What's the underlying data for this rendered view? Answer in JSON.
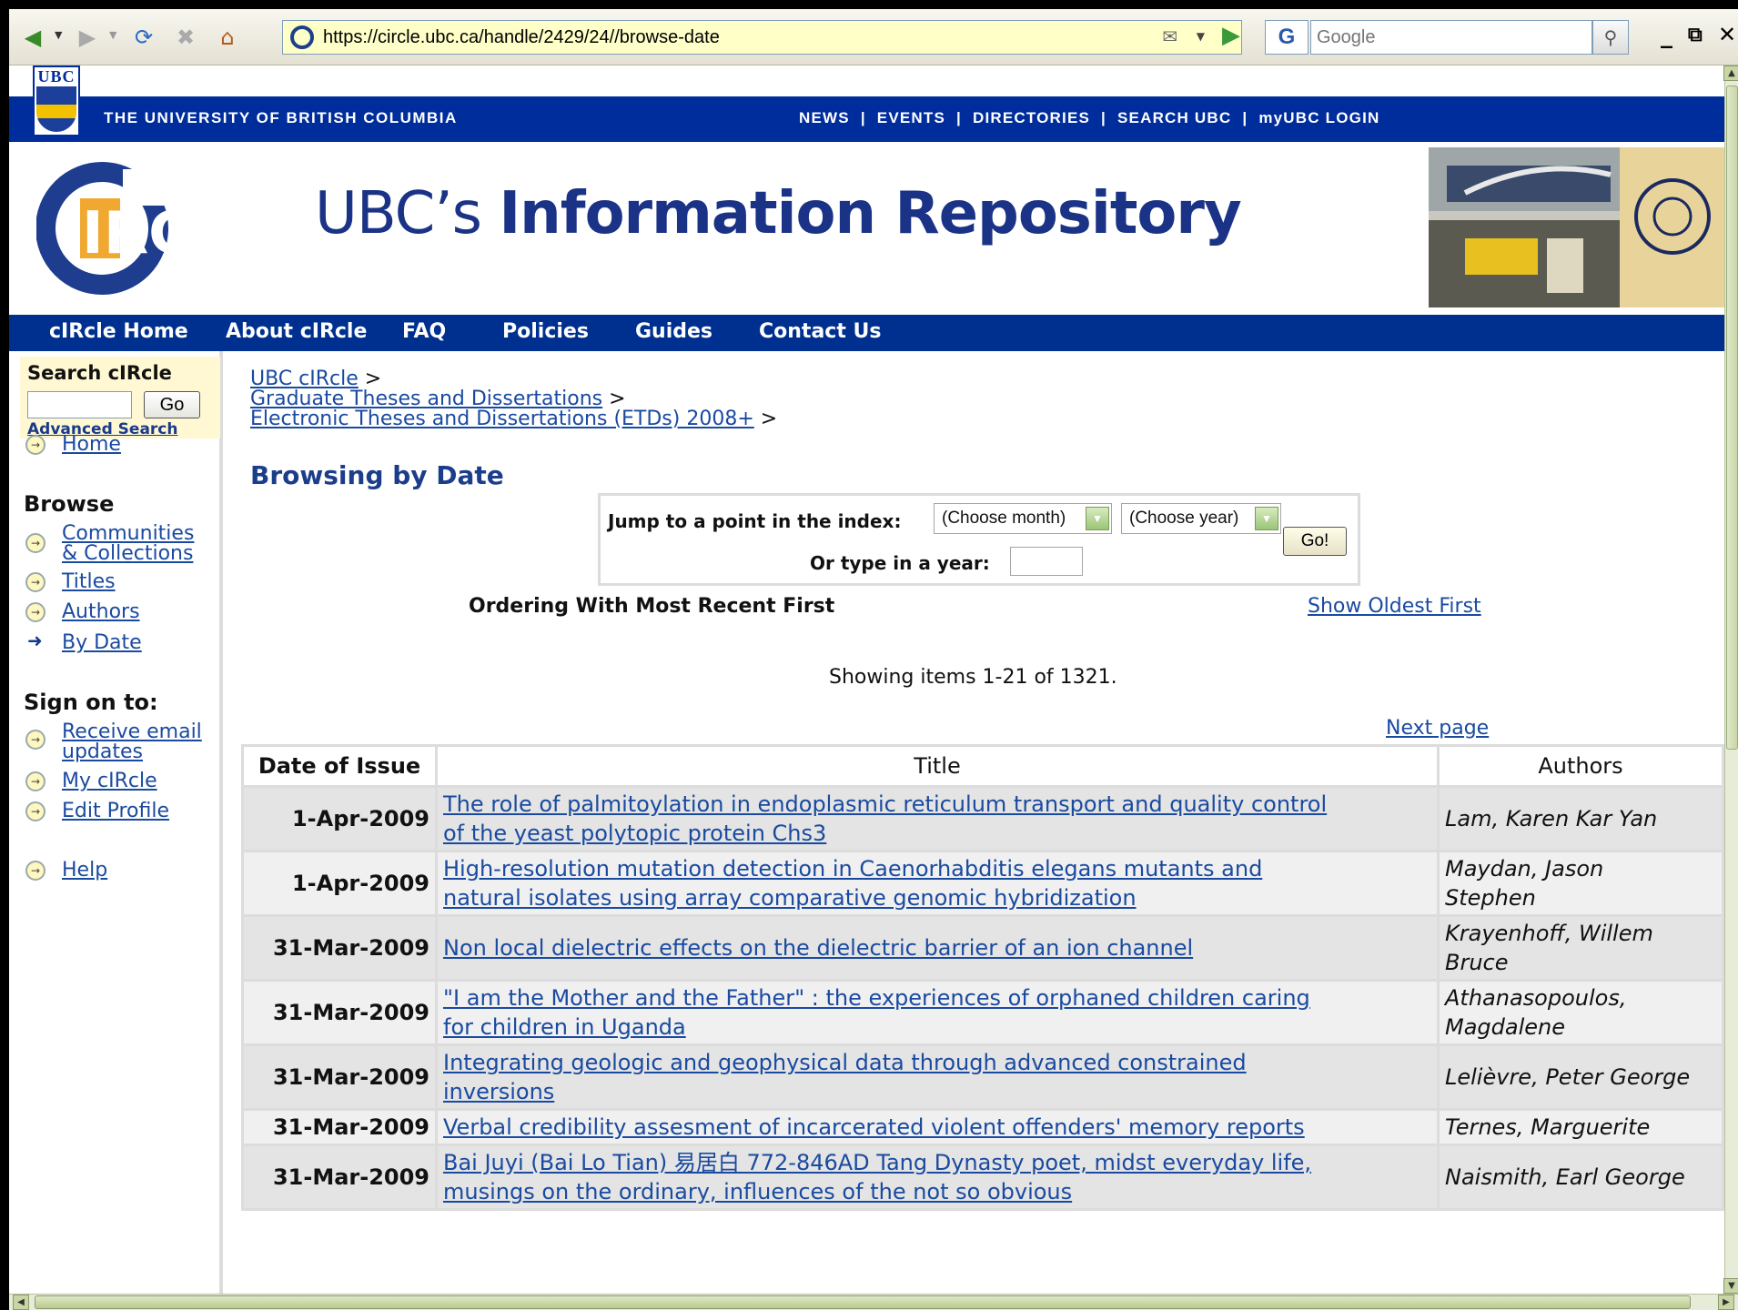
{
  "browser": {
    "url": "https://circle.ubc.ca/handle/2429/24//browse-date",
    "search_placeholder": "Google",
    "search_engine_label": "G"
  },
  "ubc_header": {
    "logo_text": "UBC",
    "university_name": "THE UNIVERSITY OF  BRITISH COLUMBIA",
    "links": [
      "NEWS",
      "EVENTS",
      "DIRECTORIES",
      "SEARCH UBC",
      "myUBC LOGIN"
    ]
  },
  "banner": {
    "logo_text": "IRCLE",
    "title_prefix": "UBC’s ",
    "title_bold": "Information Repository"
  },
  "nav": {
    "items": [
      "cIRcle Home",
      "About cIRcle",
      "FAQ",
      "Policies",
      "Guides",
      "Contact Us"
    ]
  },
  "sidebar": {
    "search_title": "Search cIRcle",
    "go_label": "Go",
    "advanced_search": "Advanced Search",
    "home": "Home",
    "browse_heading": "Browse",
    "browse_items": [
      "Communities",
      "& Collections",
      "Titles",
      "Authors",
      "By Date"
    ],
    "signon_heading": "Sign on to:",
    "signon_items": [
      "Receive email",
      "updates",
      "My cIRcle",
      "Edit Profile"
    ],
    "help": "Help"
  },
  "breadcrumbs": [
    "UBC cIRcle",
    "Graduate Theses and Dissertations",
    "Electronic Theses and Dissertations (ETDs) 2008+"
  ],
  "breadcrumb_sep": ">",
  "page_title": "Browsing by Date",
  "jump": {
    "label": "Jump to a point in the index:",
    "month_select": "(Choose month)",
    "year_select": "(Choose year)",
    "year_label": "Or type in a year:",
    "go_label": "Go!"
  },
  "ordering_text": "Ordering With Most Recent First",
  "show_oldest": "Show Oldest First",
  "showing": "Showing items 1-21 of 1321.",
  "next_page": "Next page",
  "table": {
    "headers": [
      "Date of Issue",
      "Title",
      "Authors"
    ],
    "rows": [
      {
        "date": "1-Apr-2009",
        "title_lines": [
          "The role of palmitoylation in endoplasmic reticulum transport and quality control",
          "of the yeast polytopic protein Chs3"
        ],
        "author_lines": [
          "Lam, Karen Kar Yan"
        ]
      },
      {
        "date": "1-Apr-2009",
        "title_lines": [
          "High-resolution mutation detection in Caenorhabditis elegans mutants and",
          "natural isolates using array comparative genomic hybridization"
        ],
        "author_lines": [
          "Maydan, Jason",
          "Stephen"
        ]
      },
      {
        "date": "31-Mar-2009",
        "title_lines": [
          "Non local dielectric effects on the dielectric barrier of an ion channel"
        ],
        "author_lines": [
          "Krayenhoff, Willem",
          "Bruce"
        ]
      },
      {
        "date": "31-Mar-2009",
        "title_lines": [
          "\"I am the Mother and the Father\" : the experiences of orphaned children caring",
          "for children in Uganda"
        ],
        "author_lines": [
          "Athanasopoulos,",
          "Magdalene"
        ]
      },
      {
        "date": "31-Mar-2009",
        "title_lines": [
          "Integrating geologic and geophysical data through advanced constrained",
          "inversions"
        ],
        "author_lines": [
          "Lelièvre, Peter George"
        ]
      },
      {
        "date": "31-Mar-2009",
        "title_lines": [
          "Verbal credibility assesment of incarcerated violent offenders' memory reports"
        ],
        "author_lines": [
          "Ternes, Marguerite"
        ]
      },
      {
        "date": "31-Mar-2009",
        "title_lines": [
          "Bai Juyi (Bai Lo Tian) 易居白 772-846AD Tang Dynasty poet, midst everyday life,",
          "musings on the ordinary, influences of the not so obvious"
        ],
        "author_lines": [
          "Naismith, Earl George"
        ]
      }
    ]
  },
  "colors": {
    "ubc_blue": "#002d9c",
    "nav_blue": "#00308f",
    "link_blue": "#1a4aa0",
    "title_blue": "#1b3d8b"
  }
}
